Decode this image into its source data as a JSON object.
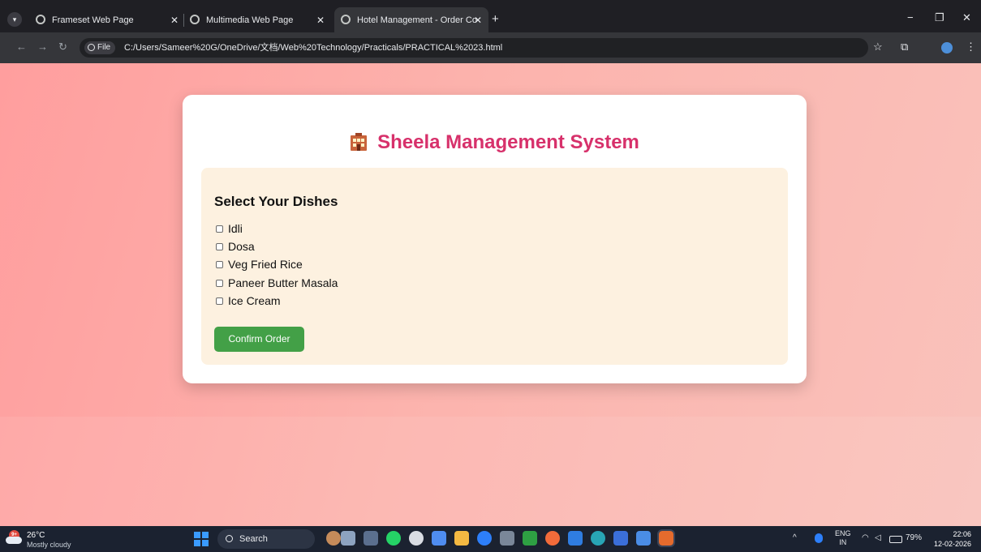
{
  "browser": {
    "tabs": [
      {
        "label": "Frameset Web Page",
        "close": "✕"
      },
      {
        "label": "Multimedia Web Page",
        "close": "✕"
      },
      {
        "label": "Hotel Management - Order Co",
        "close": "✕"
      }
    ],
    "new_tab": "+",
    "window_controls": {
      "minimize": "−",
      "restore": "❐",
      "close": "✕"
    },
    "address": {
      "chip": "File",
      "url": "C:/Users/Sameer%20G/OneDrive/文档/Web%20Technology/Practicals/PRACTICAL%2023.html"
    },
    "nav": {
      "back": "←",
      "forward": "→",
      "reload": "↻"
    },
    "icons": {
      "star": "☆",
      "extensions": "⧉",
      "menu": "⋮"
    }
  },
  "page": {
    "title": "Sheela Management System",
    "section_heading": "Select Your Dishes",
    "dishes": [
      {
        "label": "Idli",
        "checked": false
      },
      {
        "label": "Dosa",
        "checked": false
      },
      {
        "label": "Veg Fried Rice",
        "checked": false
      },
      {
        "label": "Paneer Butter Masala",
        "checked": false
      },
      {
        "label": "Ice Cream",
        "checked": false
      }
    ],
    "confirm_label": "Confirm Order",
    "colors": {
      "title": "#d7316b",
      "panel": "#fdf1e0",
      "button": "#43a047"
    }
  },
  "taskbar": {
    "weather": {
      "temp": "26°C",
      "condition": "Mostly cloudy",
      "badge": "9+"
    },
    "search_placeholder": "Search",
    "tray": {
      "chevron": "^",
      "language": "ENG",
      "region": "IN",
      "battery": "79%"
    },
    "clock": {
      "time": "22:06",
      "date": "12-02-2026"
    }
  }
}
